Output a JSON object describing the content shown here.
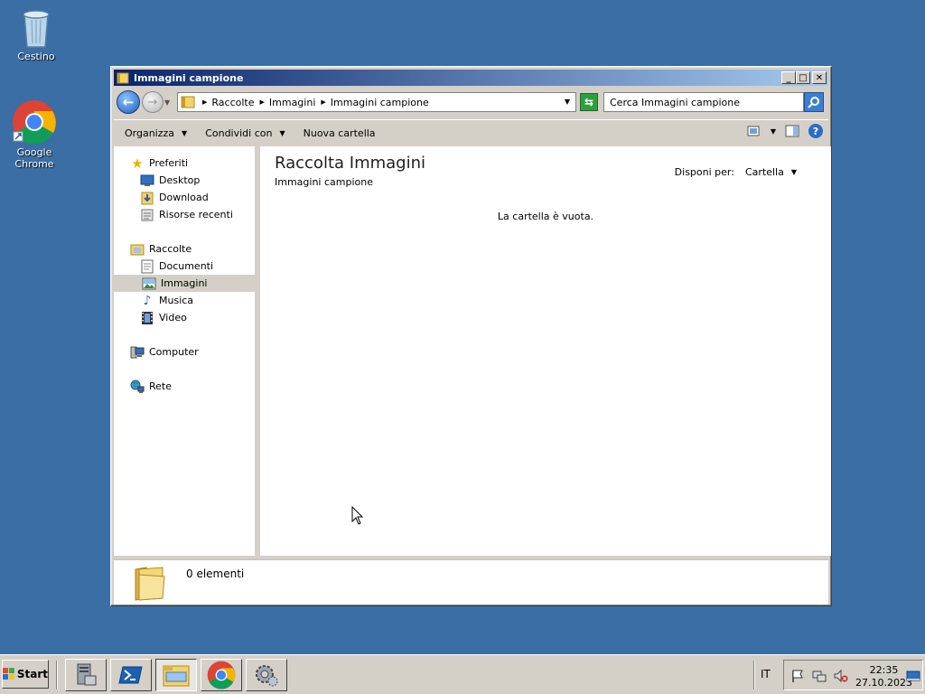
{
  "desktop": {
    "icons": [
      {
        "label": "Cestino",
        "icon": "recycle-bin-icon"
      },
      {
        "label": "Google Chrome",
        "icon": "chrome-icon"
      }
    ]
  },
  "window": {
    "title": "Immagini campione",
    "controls": {
      "minimize": "_",
      "maximize": "□",
      "close": "✕"
    },
    "address": {
      "crumbs": [
        "Raccolte",
        "Immagini",
        "Immagini campione"
      ]
    },
    "search": {
      "placeholder": "Cerca Immagini campione"
    },
    "toolbar": {
      "organize": "Organizza",
      "share": "Condividi con",
      "new_folder": "Nuova cartella"
    },
    "nav": {
      "favorites": "Preferiti",
      "favorites_items": [
        "Desktop",
        "Download",
        "Risorse recenti"
      ],
      "libraries": "Raccolte",
      "libraries_items": [
        "Documenti",
        "Immagini",
        "Musica",
        "Video"
      ],
      "selected": "Immagini",
      "computer": "Computer",
      "network": "Rete"
    },
    "content": {
      "title": "Raccolta Immagini",
      "subtitle": "Immagini campione",
      "arrange_label": "Disponi per:",
      "arrange_value": "Cartella",
      "empty_message": "La cartella è vuota."
    },
    "details": {
      "count": "0 elementi"
    }
  },
  "taskbar": {
    "start": "Start",
    "language": "IT",
    "time": "22:35",
    "date": "27.10.2023"
  },
  "colors": {
    "desktop": "#3a6ea5",
    "title_start": "#0a246a",
    "title_end": "#a6caf0",
    "face": "#d4d0c8"
  }
}
